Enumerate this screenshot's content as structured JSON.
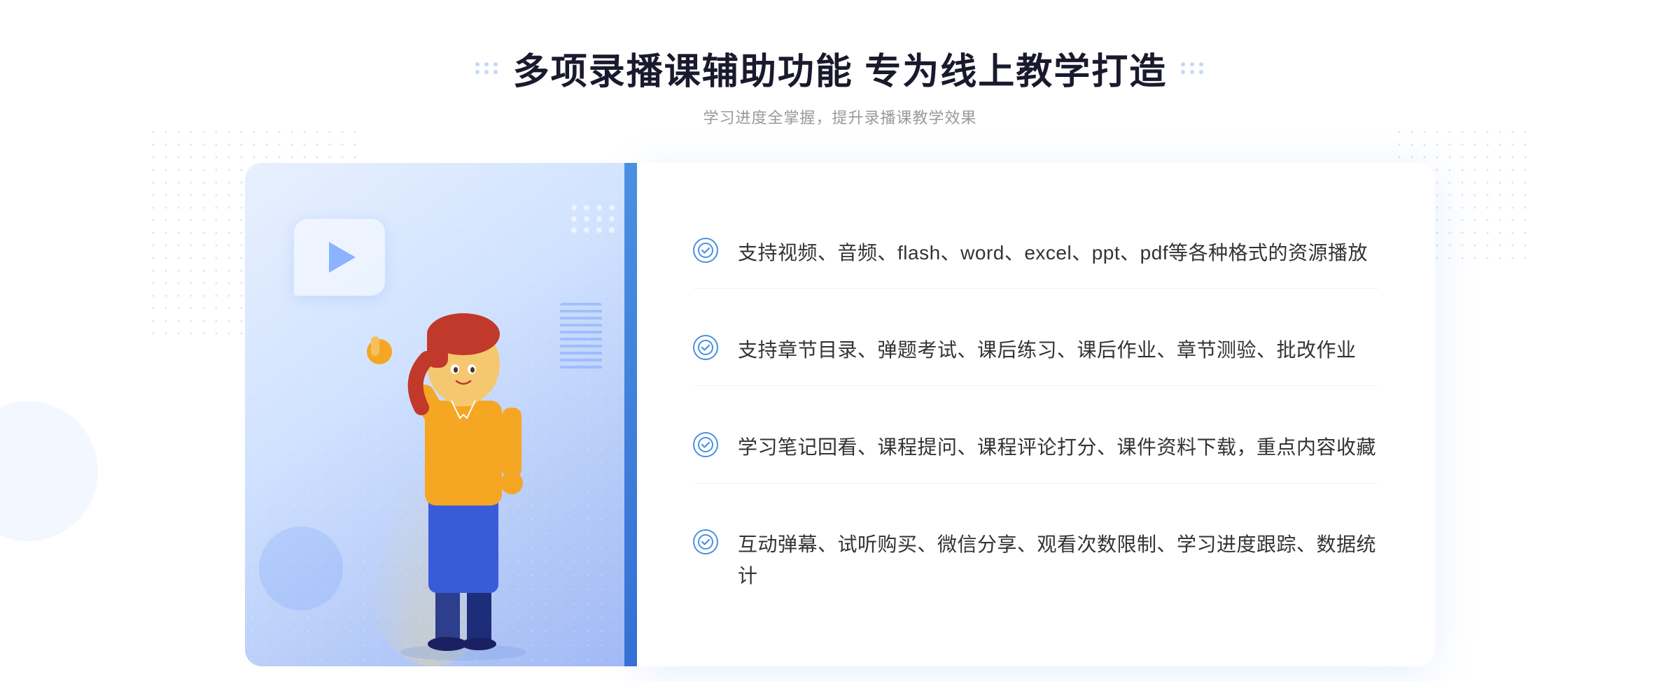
{
  "header": {
    "title": "多项录播课辅助功能 专为线上教学打造",
    "subtitle": "学习进度全掌握，提升录播课教学效果",
    "decoration_dots": "dots-grid"
  },
  "features": [
    {
      "id": 1,
      "text": "支持视频、音频、flash、word、excel、ppt、pdf等各种格式的资源播放"
    },
    {
      "id": 2,
      "text": "支持章节目录、弹题考试、课后练习、课后作业、章节测验、批改作业"
    },
    {
      "id": 3,
      "text": "学习笔记回看、课程提问、课程评论打分、课件资料下载，重点内容收藏"
    },
    {
      "id": 4,
      "text": "互动弹幕、试听购买、微信分享、观看次数限制、学习进度跟踪、数据统计"
    }
  ],
  "colors": {
    "primary": "#4a90e2",
    "title": "#1a1a2e",
    "text": "#333333",
    "subtitle": "#999999",
    "accent": "#3570d4"
  },
  "chevrons": "»"
}
